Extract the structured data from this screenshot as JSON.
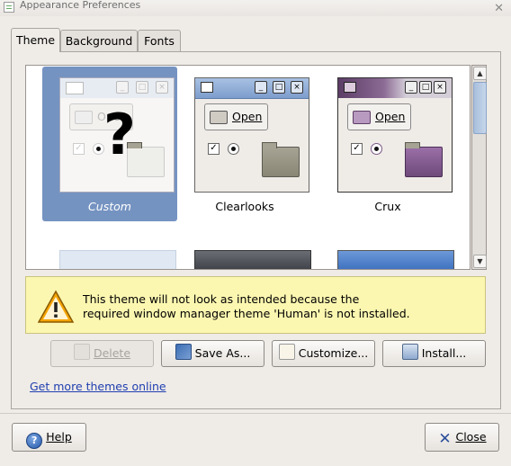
{
  "window": {
    "title": "Appearance Preferences",
    "icon": "appearance-app-icon",
    "close_glyph": "✕"
  },
  "tabs": [
    {
      "label": "Theme",
      "active": true
    },
    {
      "label": "Background",
      "active": false
    },
    {
      "label": "Fonts",
      "active": false
    }
  ],
  "themes": [
    {
      "name": "Custom",
      "selected": true,
      "preview": {
        "open_label": "Open",
        "overlay": "?"
      }
    },
    {
      "name": "Clearlooks",
      "selected": false,
      "preview": {
        "open_label": "Open"
      }
    },
    {
      "name": "Crux",
      "selected": false,
      "preview": {
        "open_label": "Open"
      }
    }
  ],
  "warning": {
    "icon": "warning-triangle-icon",
    "line1": "This theme will not look as intended because the",
    "line2": "required window manager theme 'Human' is not installed."
  },
  "actions": {
    "delete": {
      "label": "Delete",
      "enabled": false
    },
    "save_as": {
      "label": "Save As..."
    },
    "customize": {
      "label": "Customize..."
    },
    "install": {
      "label": "Install..."
    }
  },
  "get_more_link": "Get more themes online",
  "footer": {
    "help": "Help",
    "close": "Close"
  },
  "colors": {
    "selection": "#7593c1",
    "warning_bg": "#fcf7b0",
    "link": "#1f3fb0"
  }
}
